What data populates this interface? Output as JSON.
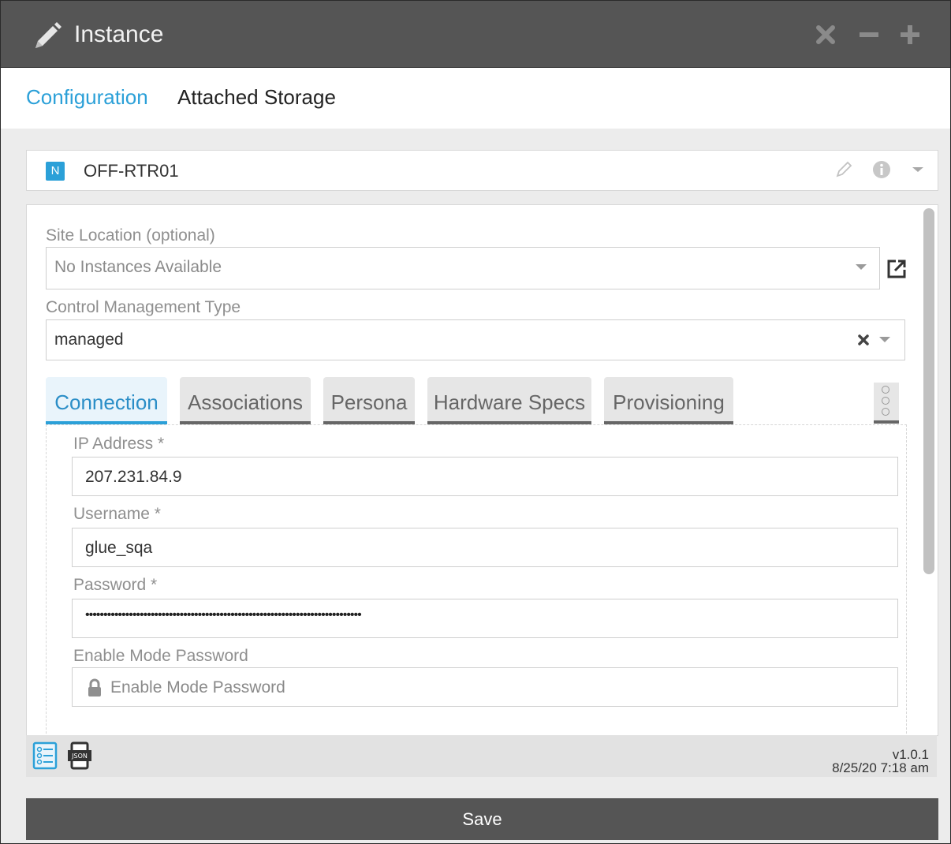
{
  "window": {
    "title": "Instance",
    "icon": "pencil-icon",
    "controls": [
      "close-icon",
      "minimize-icon",
      "maximize-icon"
    ]
  },
  "top_tabs": {
    "active": "Configuration",
    "second": "Attached Storage"
  },
  "instance_header": {
    "badge": "N",
    "name": "OFF-RTR01",
    "icons": [
      "edit-pencil-icon",
      "info-icon",
      "chevron-down-icon"
    ]
  },
  "form": {
    "site_location": {
      "label": "Site Location (optional)",
      "value": "No Instances Available"
    },
    "control_management": {
      "label": "Control Management Type",
      "value": "managed"
    },
    "tabs": [
      "Connection",
      "Associations",
      "Persona",
      "Hardware Specs",
      "Provisioning"
    ],
    "active_tab": "Connection",
    "connection": {
      "ip_label": "IP Address *",
      "ip_value": "207.231.84.9",
      "user_label": "Username *",
      "user_value": "glue_sqa",
      "pass_label": "Password *",
      "pass_value": "••••••••••••••••••••••••••••••••••••••••••••••••••••••••••••••••••••••••••••",
      "enable_label": "Enable Mode Password",
      "enable_placeholder": "Enable Mode Password"
    }
  },
  "footer": {
    "version": "v1.0.1",
    "timestamp": "8/25/20 7:18 am",
    "icons": [
      "form-view-icon",
      "json-view-icon"
    ]
  },
  "save_label": "Save",
  "colors": {
    "titlebar": "#555555",
    "accent": "#2ba0d8",
    "footer_bg": "#e2e2e2"
  }
}
